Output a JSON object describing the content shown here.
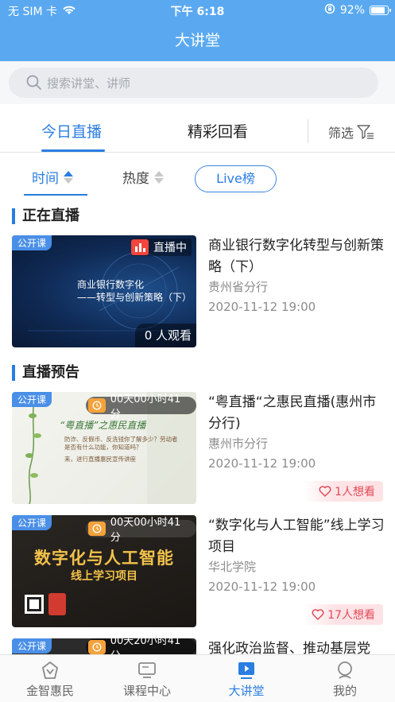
{
  "status_bar": {
    "carrier": "无 SIM 卡",
    "time": "下午 6:18",
    "battery": "92%",
    "battery_level": 0.92
  },
  "nav": {
    "title": "大讲堂"
  },
  "search": {
    "placeholder": "搜索讲堂、讲师"
  },
  "tabs": {
    "today_live": "今日直播",
    "replay": "精彩回看",
    "filter": "筛选"
  },
  "sort": {
    "time": "时间",
    "heat": "热度",
    "live_rank": "Live榜"
  },
  "sections": {
    "live_now": "正在直播",
    "preview": "直播预告"
  },
  "live_card": {
    "tag": "公开课",
    "status": "直播中",
    "viewers": "0 人观看",
    "thumb_title_line1": "商业银行数字化",
    "thumb_title_line2": "——转型与创新策略（下）",
    "title": "商业银行数字化转型与创新策略（下）",
    "org": "贵州省分行",
    "time": "2020-11-12 19:00"
  },
  "preview_cards": [
    {
      "tag": "公开课",
      "countdown": "00天00小时41分",
      "thumb_heading": "“粤直播”之惠民直播",
      "thumb_line1": "防诈、反假币、反洗钱你了解多少？劳动者",
      "thumb_line2": "是否有什么功能，你知道吗？",
      "thumb_line3": "来，进行直播惠民宣传讲座",
      "title": "“粤直播“之惠民直播(惠州市分行)",
      "org": "惠州市分行",
      "time": "2020-11-12 19:00",
      "want": "1人想看"
    },
    {
      "tag": "公开课",
      "countdown": "00天00小时41分",
      "thumb_heading": "数字化与人工智能",
      "thumb_sub": "线上学习项目",
      "title": "“数字化与人工智能”线上学习项目",
      "org": "华北学院",
      "time": "2020-11-12 19:00",
      "want": "17人想看"
    },
    {
      "tag": "公开课",
      "countdown": "00天20小时41分",
      "title": "强化政治监督、推动基层党"
    }
  ],
  "tab_bar": {
    "home": "金智惠民",
    "courses": "课程中心",
    "lecture": "大讲堂",
    "mine": "我的"
  },
  "colors": {
    "brand_blue": "#5aa9f0",
    "accent": "#2a7de1",
    "want_red": "#e34b5a",
    "countdown_orange": "#f6a23a"
  }
}
